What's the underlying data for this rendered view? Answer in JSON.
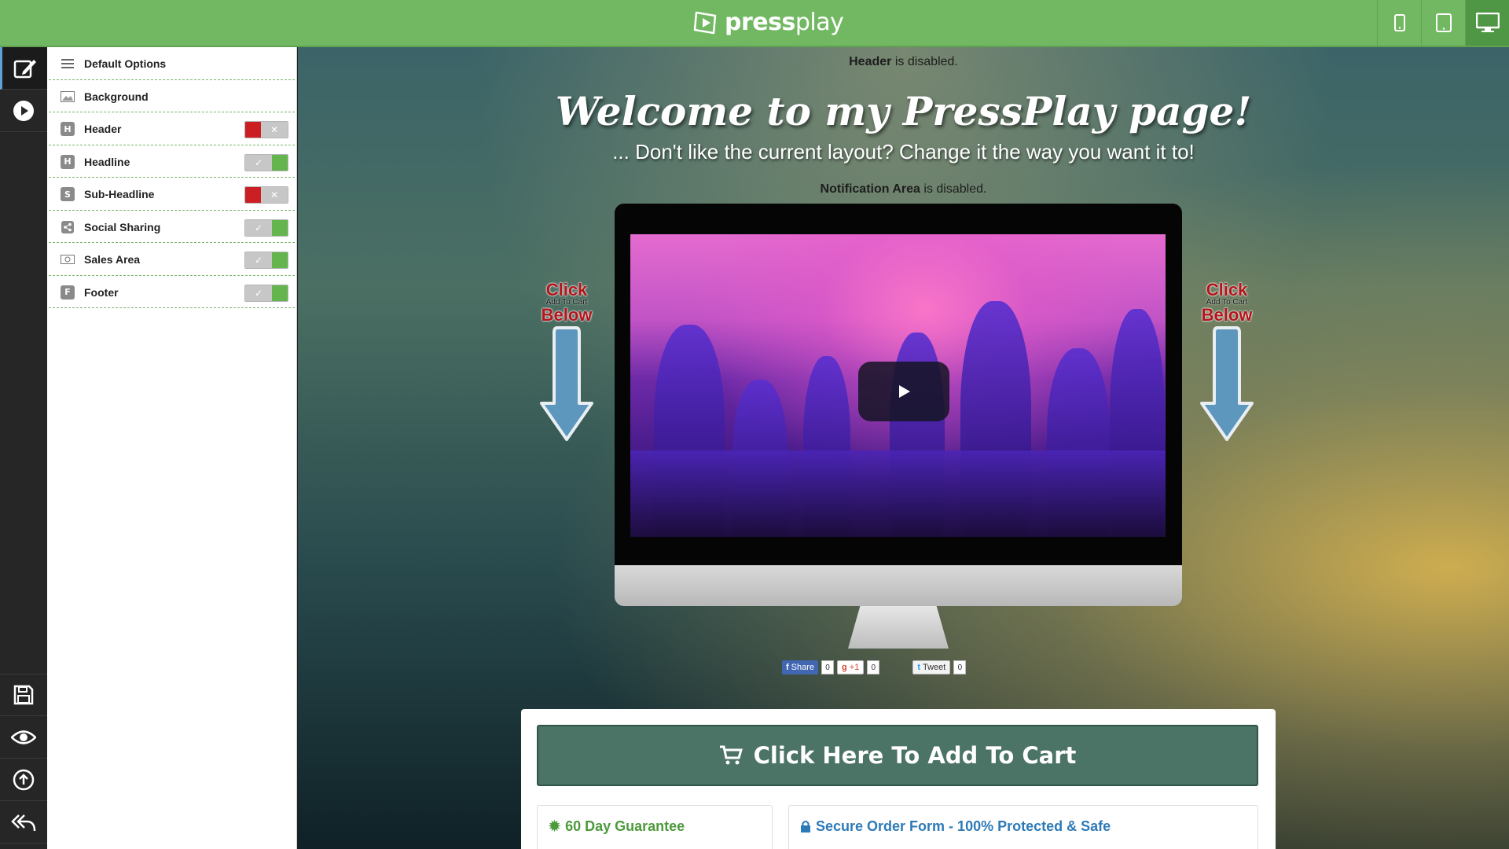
{
  "app": {
    "logo_bold": "press",
    "logo_light": "play"
  },
  "devices": [
    {
      "name": "mobile",
      "icon": "phone-icon"
    },
    {
      "name": "tablet",
      "icon": "tablet-icon"
    },
    {
      "name": "desktop",
      "icon": "desktop-icon",
      "active": true
    }
  ],
  "rail": {
    "top": [
      "edit-icon",
      "play-circle-icon"
    ],
    "bottom": [
      "save-icon",
      "eye-icon",
      "upload-icon",
      "reply-all-icon"
    ]
  },
  "options": [
    {
      "label": "Default Options",
      "icon": "menu-icon",
      "toggle": null
    },
    {
      "label": "Background",
      "icon": "image-icon",
      "toggle": null
    },
    {
      "label": "Header",
      "icon": "H",
      "toggle": "off"
    },
    {
      "label": "Headline",
      "icon": "H",
      "toggle": "on"
    },
    {
      "label": "Sub-Headline",
      "icon": "S",
      "toggle": "off"
    },
    {
      "label": "Social Sharing",
      "icon": "share-icon",
      "toggle": "on"
    },
    {
      "label": "Sales Area",
      "icon": "money-icon",
      "toggle": "on"
    },
    {
      "label": "Footer",
      "icon": "F",
      "toggle": "on"
    }
  ],
  "preview": {
    "header_notice_bold": "Header",
    "header_notice_rest": " is disabled.",
    "headline": "Welcome to my PressPlay page!",
    "subheadline": "... Don't like the current layout? Change it the way you want it to!",
    "notification_bold": "Notification Area",
    "notification_rest": " is disabled.",
    "arrow": {
      "click": "Click",
      "small": "Add To Cart",
      "below": "Below"
    },
    "social": {
      "share_label": "Share",
      "share_count": "0",
      "gplus_label": "+1",
      "gplus_count": "0",
      "tweet_label": "Tweet",
      "tweet_count": "0"
    },
    "sales": {
      "cart_button": "Click Here To Add To Cart",
      "guarantee": "60 Day Guarantee",
      "secure": "Secure Order Form - 100% Protected & Safe"
    }
  },
  "colors": {
    "topbar": "#72b862",
    "toggle_on": "#64b54d",
    "toggle_off": "#cc1f24",
    "cart_button": "#4c7466",
    "guarantee": "#4c9a3b",
    "secure": "#2d7ab8"
  }
}
